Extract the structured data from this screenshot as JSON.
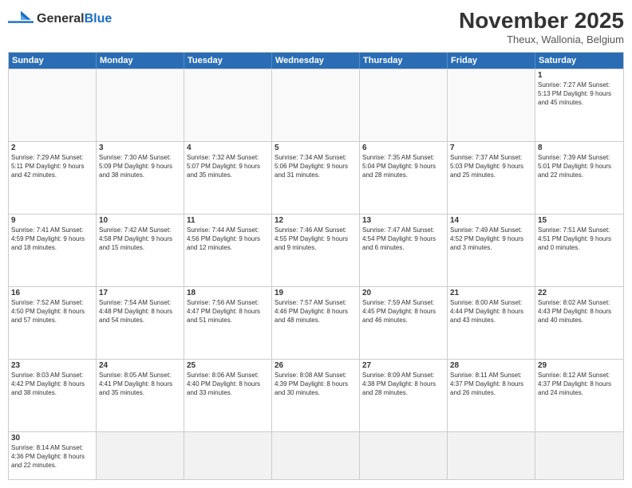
{
  "logo": {
    "text_general": "General",
    "text_blue": "Blue"
  },
  "header": {
    "title": "November 2025",
    "location": "Theux, Wallonia, Belgium"
  },
  "days_of_week": [
    "Sunday",
    "Monday",
    "Tuesday",
    "Wednesday",
    "Thursday",
    "Friday",
    "Saturday"
  ],
  "weeks": [
    [
      {
        "num": "",
        "info": ""
      },
      {
        "num": "",
        "info": ""
      },
      {
        "num": "",
        "info": ""
      },
      {
        "num": "",
        "info": ""
      },
      {
        "num": "",
        "info": ""
      },
      {
        "num": "",
        "info": ""
      },
      {
        "num": "1",
        "info": "Sunrise: 7:27 AM\nSunset: 5:13 PM\nDaylight: 9 hours and 45 minutes."
      }
    ],
    [
      {
        "num": "2",
        "info": "Sunrise: 7:29 AM\nSunset: 5:11 PM\nDaylight: 9 hours and 42 minutes."
      },
      {
        "num": "3",
        "info": "Sunrise: 7:30 AM\nSunset: 5:09 PM\nDaylight: 9 hours and 38 minutes."
      },
      {
        "num": "4",
        "info": "Sunrise: 7:32 AM\nSunset: 5:07 PM\nDaylight: 9 hours and 35 minutes."
      },
      {
        "num": "5",
        "info": "Sunrise: 7:34 AM\nSunset: 5:06 PM\nDaylight: 9 hours and 31 minutes."
      },
      {
        "num": "6",
        "info": "Sunrise: 7:35 AM\nSunset: 5:04 PM\nDaylight: 9 hours and 28 minutes."
      },
      {
        "num": "7",
        "info": "Sunrise: 7:37 AM\nSunset: 5:03 PM\nDaylight: 9 hours and 25 minutes."
      },
      {
        "num": "8",
        "info": "Sunrise: 7:39 AM\nSunset: 5:01 PM\nDaylight: 9 hours and 22 minutes."
      }
    ],
    [
      {
        "num": "9",
        "info": "Sunrise: 7:41 AM\nSunset: 4:59 PM\nDaylight: 9 hours and 18 minutes."
      },
      {
        "num": "10",
        "info": "Sunrise: 7:42 AM\nSunset: 4:58 PM\nDaylight: 9 hours and 15 minutes."
      },
      {
        "num": "11",
        "info": "Sunrise: 7:44 AM\nSunset: 4:56 PM\nDaylight: 9 hours and 12 minutes."
      },
      {
        "num": "12",
        "info": "Sunrise: 7:46 AM\nSunset: 4:55 PM\nDaylight: 9 hours and 9 minutes."
      },
      {
        "num": "13",
        "info": "Sunrise: 7:47 AM\nSunset: 4:54 PM\nDaylight: 9 hours and 6 minutes."
      },
      {
        "num": "14",
        "info": "Sunrise: 7:49 AM\nSunset: 4:52 PM\nDaylight: 9 hours and 3 minutes."
      },
      {
        "num": "15",
        "info": "Sunrise: 7:51 AM\nSunset: 4:51 PM\nDaylight: 9 hours and 0 minutes."
      }
    ],
    [
      {
        "num": "16",
        "info": "Sunrise: 7:52 AM\nSunset: 4:50 PM\nDaylight: 8 hours and 57 minutes."
      },
      {
        "num": "17",
        "info": "Sunrise: 7:54 AM\nSunset: 4:48 PM\nDaylight: 8 hours and 54 minutes."
      },
      {
        "num": "18",
        "info": "Sunrise: 7:56 AM\nSunset: 4:47 PM\nDaylight: 8 hours and 51 minutes."
      },
      {
        "num": "19",
        "info": "Sunrise: 7:57 AM\nSunset: 4:46 PM\nDaylight: 8 hours and 48 minutes."
      },
      {
        "num": "20",
        "info": "Sunrise: 7:59 AM\nSunset: 4:45 PM\nDaylight: 8 hours and 46 minutes."
      },
      {
        "num": "21",
        "info": "Sunrise: 8:00 AM\nSunset: 4:44 PM\nDaylight: 8 hours and 43 minutes."
      },
      {
        "num": "22",
        "info": "Sunrise: 8:02 AM\nSunset: 4:43 PM\nDaylight: 8 hours and 40 minutes."
      }
    ],
    [
      {
        "num": "23",
        "info": "Sunrise: 8:03 AM\nSunset: 4:42 PM\nDaylight: 8 hours and 38 minutes."
      },
      {
        "num": "24",
        "info": "Sunrise: 8:05 AM\nSunset: 4:41 PM\nDaylight: 8 hours and 35 minutes."
      },
      {
        "num": "25",
        "info": "Sunrise: 8:06 AM\nSunset: 4:40 PM\nDaylight: 8 hours and 33 minutes."
      },
      {
        "num": "26",
        "info": "Sunrise: 8:08 AM\nSunset: 4:39 PM\nDaylight: 8 hours and 30 minutes."
      },
      {
        "num": "27",
        "info": "Sunrise: 8:09 AM\nSunset: 4:38 PM\nDaylight: 8 hours and 28 minutes."
      },
      {
        "num": "28",
        "info": "Sunrise: 8:11 AM\nSunset: 4:37 PM\nDaylight: 8 hours and 26 minutes."
      },
      {
        "num": "29",
        "info": "Sunrise: 8:12 AM\nSunset: 4:37 PM\nDaylight: 8 hours and 24 minutes."
      }
    ],
    [
      {
        "num": "30",
        "info": "Sunrise: 8:14 AM\nSunset: 4:36 PM\nDaylight: 8 hours and 22 minutes."
      },
      {
        "num": "",
        "info": ""
      },
      {
        "num": "",
        "info": ""
      },
      {
        "num": "",
        "info": ""
      },
      {
        "num": "",
        "info": ""
      },
      {
        "num": "",
        "info": ""
      },
      {
        "num": "",
        "info": ""
      }
    ]
  ]
}
